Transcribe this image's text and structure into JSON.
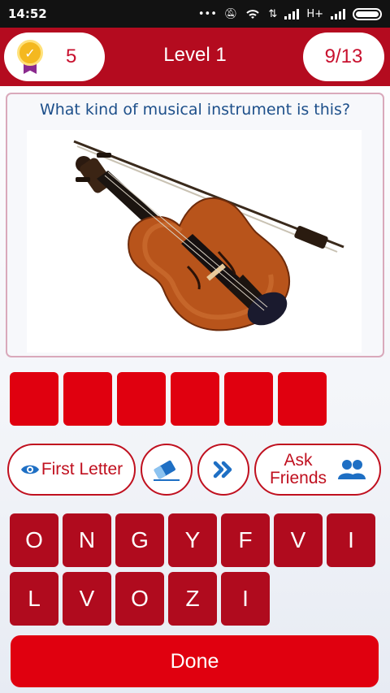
{
  "status_bar": {
    "time": "14:52",
    "network": "H+"
  },
  "header": {
    "coins": "5",
    "level": "Level 1",
    "progress": "9/13"
  },
  "question": {
    "text": "What kind of musical instrument is this?",
    "image": "violin-with-bow"
  },
  "answer": {
    "slots": [
      "",
      "",
      "",
      "",
      "",
      ""
    ]
  },
  "hints": {
    "first_letter": "First Letter",
    "ask_line1": "Ask",
    "ask_line2": "Friends"
  },
  "keyboard": {
    "row1": [
      "O",
      "N",
      "G",
      "Y",
      "F",
      "V",
      "I"
    ],
    "row2": [
      "L",
      "V",
      "O",
      "Z",
      "I"
    ]
  },
  "done_label": "Done",
  "colors": {
    "brand_red": "#b40b1f",
    "slot_red": "#e0000f",
    "question_blue": "#1d4f8a"
  }
}
